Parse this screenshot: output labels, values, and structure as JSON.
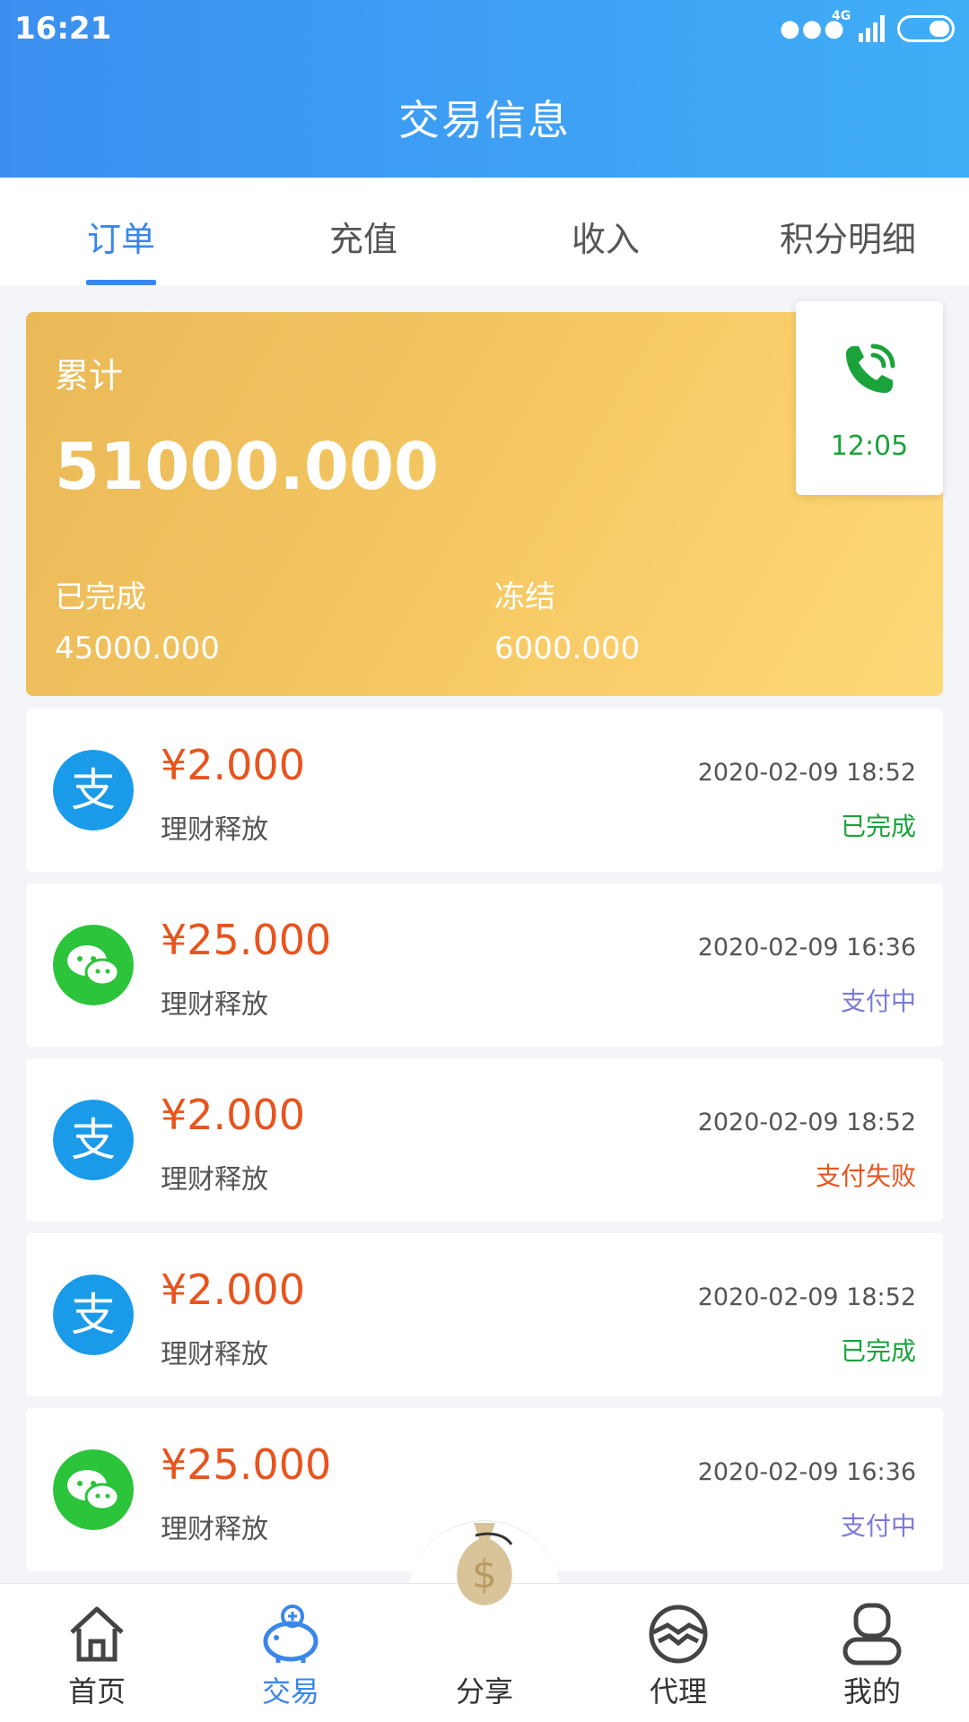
{
  "status_bar": {
    "time": "16:21",
    "network": "4G"
  },
  "header": {
    "title": "交易信息"
  },
  "tabs": [
    "订单",
    "充值",
    "收入",
    "积分明细"
  ],
  "summary": {
    "total_label": "累计",
    "total_value": "51000.000",
    "completed_label": "已完成",
    "completed_value": "45000.000",
    "frozen_label": "冻结",
    "frozen_value": "6000.000"
  },
  "call_widget": {
    "time": "12:05",
    "icon": "phone-icon"
  },
  "orders": [
    {
      "method": "alipay",
      "amount": "¥2.000",
      "desc": "理财释放",
      "time": "2020-02-09 18:52",
      "status": "已完成",
      "status_color": "#1aa33a"
    },
    {
      "method": "wechat",
      "amount": "¥25.000",
      "desc": "理财释放",
      "time": "2020-02-09 16:36",
      "status": "支付中",
      "status_color": "#7b7bd6"
    },
    {
      "method": "alipay",
      "amount": "¥2.000",
      "desc": "理财释放",
      "time": "2020-02-09 18:52",
      "status": "支付失败",
      "status_color": "#e8541e"
    },
    {
      "method": "alipay",
      "amount": "¥2.000",
      "desc": "理财释放",
      "time": "2020-02-09 18:52",
      "status": "已完成",
      "status_color": "#1aa33a"
    },
    {
      "method": "wechat",
      "amount": "¥25.000",
      "desc": "理财释放",
      "time": "2020-02-09 16:36",
      "status": "支付中",
      "status_color": "#7b7bd6"
    }
  ],
  "bottom_nav": [
    {
      "label": "首页",
      "icon": "home-icon"
    },
    {
      "label": "交易",
      "icon": "piggy-bank-icon",
      "active": true
    },
    {
      "label": "分享",
      "icon": "money-bag-icon"
    },
    {
      "label": "代理",
      "icon": "handshake-icon"
    },
    {
      "label": "我的",
      "icon": "user-icon"
    }
  ],
  "colors": {
    "header_start": "#3b8ff0",
    "header_end": "#40aef7",
    "accent": "#3a86ea",
    "amount": "#e8541e",
    "alipay": "#1a9be9",
    "wechat": "#2bc43a"
  }
}
